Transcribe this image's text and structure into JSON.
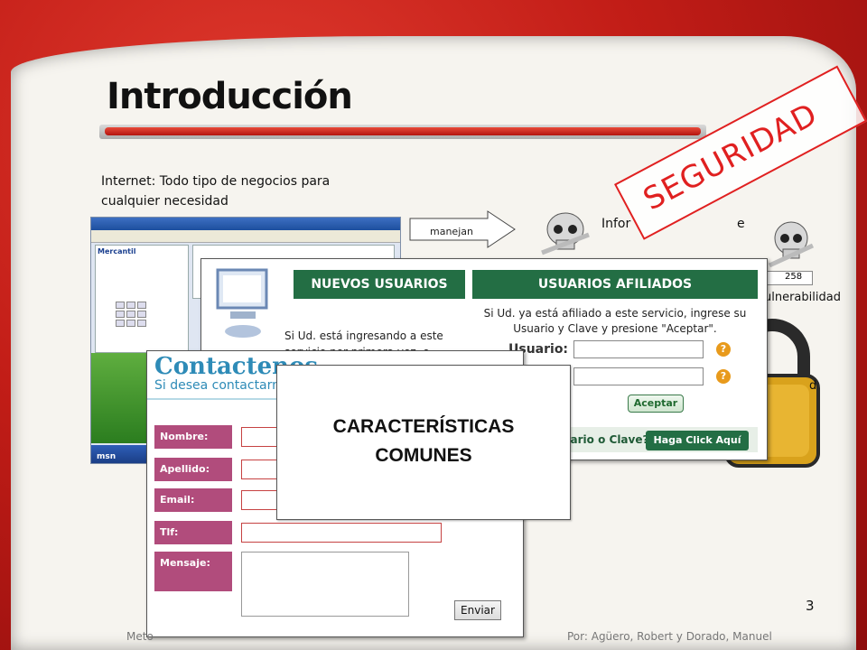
{
  "slide": {
    "title": "Introducción",
    "page_number": "3",
    "footer_left": "Meto",
    "footer_right": "Por: Agüero, Robert y Dorado, Manuel"
  },
  "intro": {
    "line1": "Internet: Todo tipo de negocios para",
    "line2": "cualquier necesidad"
  },
  "arrow_label": "manejan",
  "info": {
    "left": "Infor",
    "right": "e"
  },
  "seguridad": "SEGURIDAD",
  "vulnerabilidad": {
    "number": "258",
    "label": "ulnerabilidad",
    "d_text": "d"
  },
  "login": {
    "new_users_header": "NUEVOS USUARIOS",
    "affiliated_header": "USUARIOS AFILIADOS",
    "left_text": "Si Ud. está ingresando a este servicio por primera vez, o",
    "right_text": "Si Ud. ya está afiliado a este servicio, ingrese su Usuario y Clave y presione \"Aceptar\".",
    "user_label": "Usuario:",
    "help": "?",
    "accept": "Aceptar",
    "forgot": "uario o Clave?",
    "click_here": "Haga Click Aquí"
  },
  "contact": {
    "title": "Contactenos",
    "subtitle": "Si desea contactarn",
    "fields": [
      "Nombre:",
      "Apellido:",
      "Email:",
      "Tlf:",
      "Mensaje:"
    ],
    "send": "Enviar"
  },
  "characteristics": {
    "line1": "CARACTERÍSTICAS",
    "line2": "COMUNES"
  },
  "browser_collage": {
    "bank_name": "Mercantil",
    "taskbar": "msn"
  }
}
